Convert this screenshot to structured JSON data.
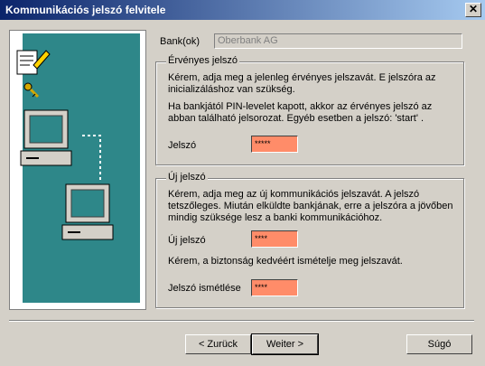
{
  "window": {
    "title": "Kommunikációs jelszó felvitele",
    "close_label": "✕"
  },
  "bank": {
    "label": "Bank(ok)",
    "value": "Oberbank AG"
  },
  "current": {
    "group_title": "Érvényes jelszó",
    "text1_line1": "Kérem, adja meg a jelenleg érvényes jelszavát. E jelszóra az",
    "text1_line2": "inicializáláshoz van szükség.",
    "text2_line1": "Ha bankjától PIN-levelet kapott, akkor az érvényes jelszó az",
    "text2_line2": "abban található jelsorozat. Egyéb esetben a jelszó: 'start' .",
    "field_label": "Jelszó",
    "field_value": "*****"
  },
  "new": {
    "group_title": "Új jelszó",
    "text1_line1": "Kérem, adja meg az új kommunikációs jelszavát. A jelszó",
    "text1_line2": "tetszőleges. Miután elküldte bankjának, erre a jelszóra a jövőben",
    "text1_line3": "mindig szüksége lesz a banki kommunikációhoz.",
    "field_label": "Új jelszó",
    "field_value": "****",
    "repeat_text": "Kérem, a biztonság kedvéért ismételje meg jelszavát.",
    "repeat_label": "Jelszó ismétlése",
    "repeat_value": "****"
  },
  "buttons": {
    "back": "< Zurück",
    "next": "Weiter >",
    "help": "Súgó"
  }
}
